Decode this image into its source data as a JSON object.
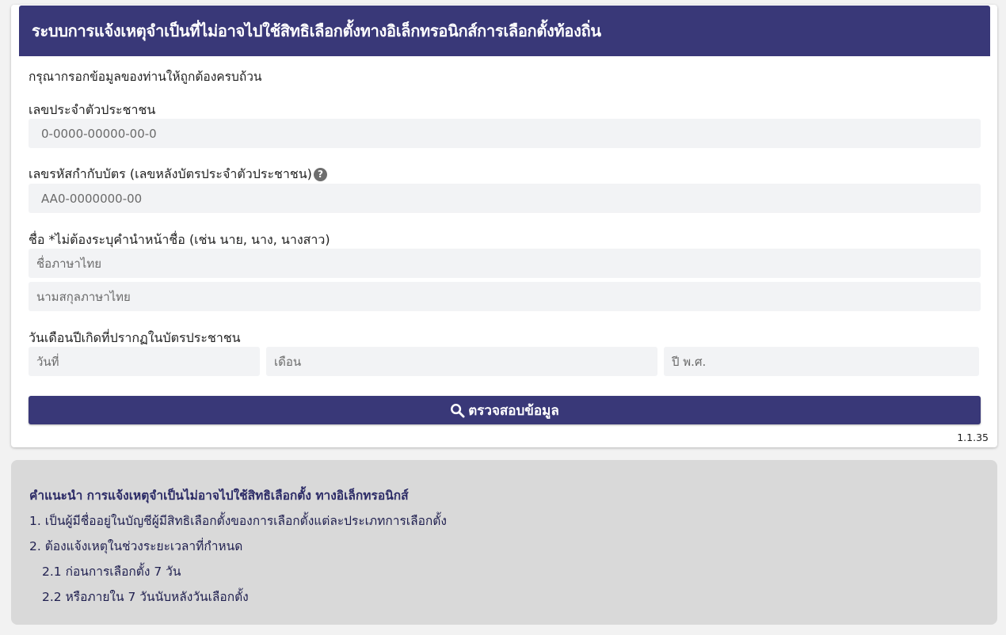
{
  "header": {
    "title": "ระบบการแจ้งเหตุจำเป็นที่ไม่อาจไปใช้สิทธิเลือกตั้งทางอิเล็กทรอนิกส์การเลือกตั้งท้องถิ่น"
  },
  "form": {
    "instruction": "กรุณากรอกข้อมูลของท่านให้ถูกต้องครบถ้วน",
    "id_label": "เลขประจำตัวประชาชน",
    "id_placeholder": "0-0000-00000-00-0",
    "laser_label": "เลขรหัสกำกับบัตร (เลขหลังบัตรประจำตัวประชาชน)",
    "laser_help_icon": "question-circle-icon",
    "laser_help_glyph": "?",
    "laser_placeholder": "AA0-0000000-00",
    "name_label": "ชื่อ *ไม่ต้องระบุคำนำหน้าชื่อ (เช่น นาย, นาง, นางสาว)",
    "firstname_placeholder": "ชื่อภาษาไทย",
    "lastname_placeholder": "นามสกุลภาษาไทย",
    "dob_label": "วันเดือนปีเกิดที่ปรากฏในบัตรประชาชน",
    "day_placeholder": "วันที่",
    "month_placeholder": "เดือน",
    "year_placeholder": "ปี พ.ศ.",
    "submit_icon": "search-icon",
    "submit_label": "ตรวจสอบข้อมูล",
    "version": "1.1.35"
  },
  "info": {
    "title": "คำแนะนำ การแจ้งเหตุจำเป็นไม่อาจไปใช้สิทธิเลือกตั้ง ทางอิเล็กทรอนิกส์",
    "lines": [
      "1. เป็นผู้มีชื่ออยู่ในบัญชีผู้มีสิทธิเลือกตั้งของการเลือกตั้งแต่ละประเภทการเลือกตั้ง",
      "2. ต้องแจ้งเหตุในช่วงระยะเวลาที่กำหนด",
      "2.1 ก่อนการเลือกตั้ง 7 วัน",
      "2.2 หรือภายใน 7 วันนับหลังวันเลือกตั้ง"
    ]
  },
  "colors": {
    "primary": "#393878",
    "field_bg": "#f2f3f5",
    "info_bg": "#d9d9d9"
  }
}
